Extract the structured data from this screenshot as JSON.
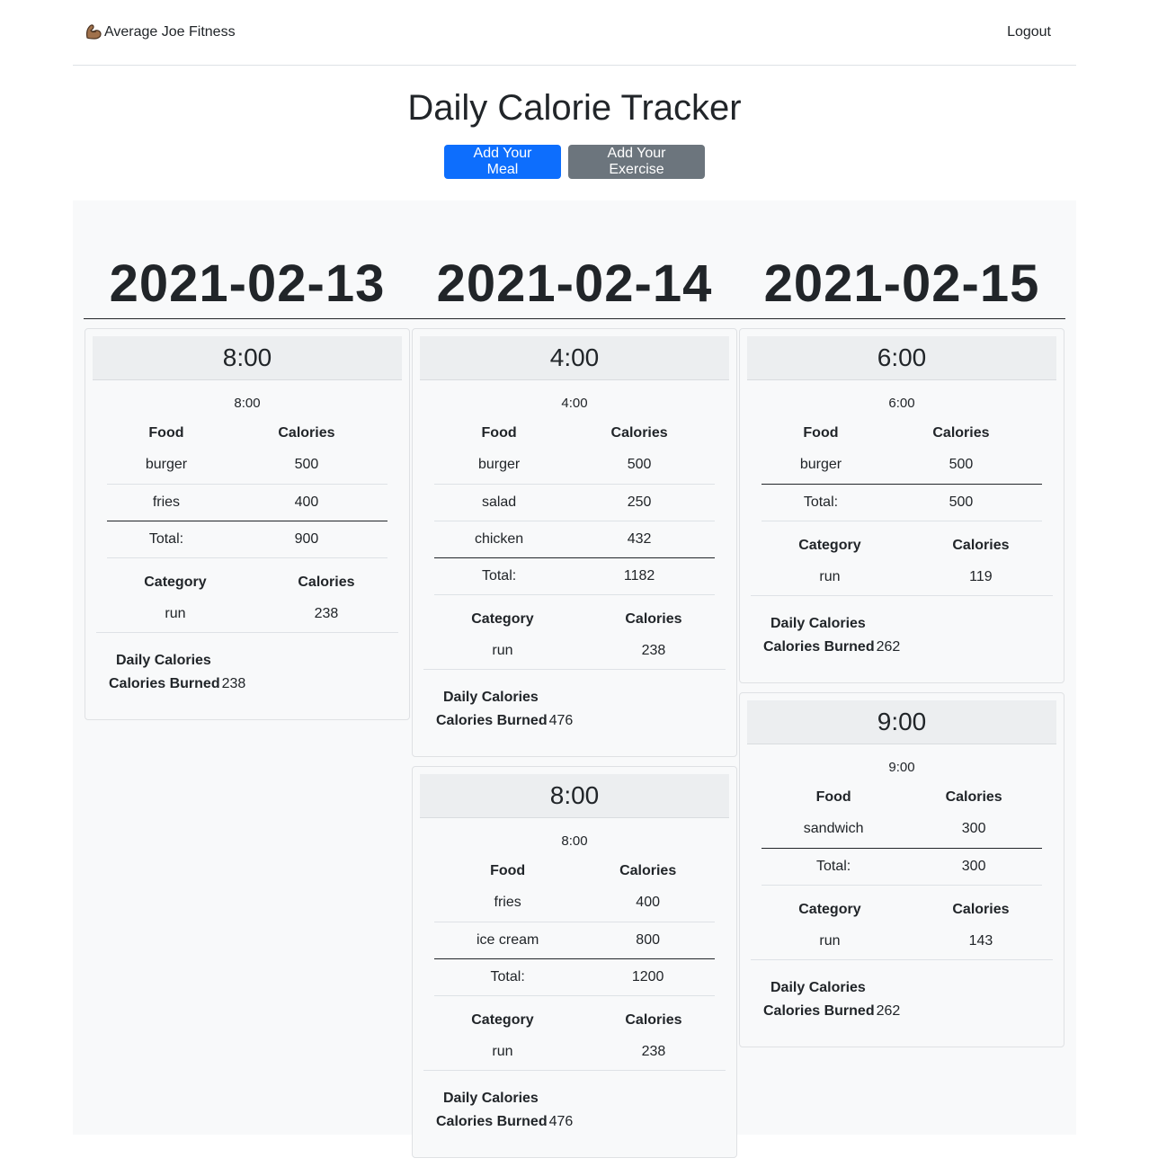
{
  "nav": {
    "brand": "Average Joe Fitness",
    "brand_icon": "flexed-biceps-icon",
    "logout": "Logout"
  },
  "page": {
    "title": "Daily Calorie Tracker",
    "add_meal": "Add Your Meal",
    "add_exercise": "Add Your Exercise"
  },
  "days": [
    {
      "date": "2021-02-13",
      "entries": [
        {
          "time": "8:00",
          "sub_time": "8:00",
          "food_header": "Food",
          "calories_header": "Calories",
          "foods": [
            {
              "name": "burger",
              "calories": "500"
            },
            {
              "name": "fries",
              "calories": "400"
            }
          ],
          "total_label": "Total:",
          "total": "900",
          "category_header": "Category",
          "exercise_calories_header": "Calories",
          "exercises": [
            {
              "category": "run",
              "calories": "238"
            }
          ],
          "daily_label": "Daily Calories",
          "burned_label": "Calories Burned",
          "burned": "238"
        }
      ]
    },
    {
      "date": "2021-02-14",
      "entries": [
        {
          "time": "4:00",
          "sub_time": "4:00",
          "food_header": "Food",
          "calories_header": "Calories",
          "foods": [
            {
              "name": "burger",
              "calories": "500"
            },
            {
              "name": "salad",
              "calories": "250"
            },
            {
              "name": "chicken",
              "calories": "432"
            }
          ],
          "total_label": "Total:",
          "total": "1182",
          "category_header": "Category",
          "exercise_calories_header": "Calories",
          "exercises": [
            {
              "category": "run",
              "calories": "238"
            }
          ],
          "daily_label": "Daily Calories",
          "burned_label": "Calories Burned",
          "burned": "476"
        },
        {
          "time": "8:00",
          "sub_time": "8:00",
          "food_header": "Food",
          "calories_header": "Calories",
          "foods": [
            {
              "name": "fries",
              "calories": "400"
            },
            {
              "name": "ice cream",
              "calories": "800"
            }
          ],
          "total_label": "Total:",
          "total": "1200",
          "category_header": "Category",
          "exercise_calories_header": "Calories",
          "exercises": [
            {
              "category": "run",
              "calories": "238"
            }
          ],
          "daily_label": "Daily Calories",
          "burned_label": "Calories Burned",
          "burned": "476"
        }
      ]
    },
    {
      "date": "2021-02-15",
      "entries": [
        {
          "time": "6:00",
          "sub_time": "6:00",
          "food_header": "Food",
          "calories_header": "Calories",
          "foods": [
            {
              "name": "burger",
              "calories": "500"
            }
          ],
          "total_label": "Total:",
          "total": "500",
          "category_header": "Category",
          "exercise_calories_header": "Calories",
          "exercises": [
            {
              "category": "run",
              "calories": "119"
            }
          ],
          "daily_label": "Daily Calories",
          "burned_label": "Calories Burned",
          "burned": "262"
        },
        {
          "time": "9:00",
          "sub_time": "9:00",
          "food_header": "Food",
          "calories_header": "Calories",
          "foods": [
            {
              "name": "sandwich",
              "calories": "300"
            }
          ],
          "total_label": "Total:",
          "total": "300",
          "category_header": "Category",
          "exercise_calories_header": "Calories",
          "exercises": [
            {
              "category": "run",
              "calories": "143"
            }
          ],
          "daily_label": "Daily Calories",
          "burned_label": "Calories Burned",
          "burned": "262"
        }
      ]
    }
  ]
}
